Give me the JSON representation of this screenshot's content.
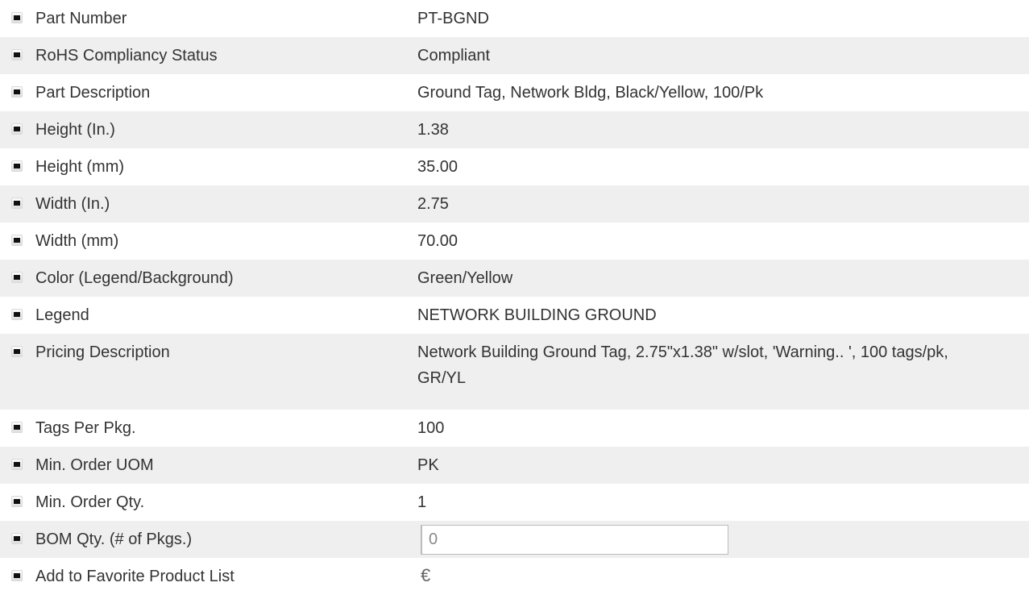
{
  "rows": [
    {
      "label": "Part Number",
      "value": "PT-BGND"
    },
    {
      "label": "RoHS Compliancy Status",
      "value": "Compliant"
    },
    {
      "label": "Part Description",
      "value": "Ground Tag, Network Bldg, Black/Yellow, 100/Pk"
    },
    {
      "label": "Height (In.)",
      "value": "1.38"
    },
    {
      "label": "Height (mm)",
      "value": "35.00"
    },
    {
      "label": "Width (In.)",
      "value": "2.75"
    },
    {
      "label": "Width (mm)",
      "value": "70.00"
    },
    {
      "label": "Color (Legend/Background)",
      "value": "Green/Yellow"
    },
    {
      "label": "Legend",
      "value": "NETWORK BUILDING GROUND"
    },
    {
      "label": "Pricing Description",
      "value": "Network Building Ground Tag, 2.75\"x1.38\" w/slot, 'Warning.. ', 100 tags/pk, GR/YL"
    },
    {
      "label": "Tags Per Pkg.",
      "value": "100"
    },
    {
      "label": "Min. Order UOM",
      "value": "PK"
    },
    {
      "label": "Min. Order Qty.",
      "value": "1"
    }
  ],
  "bom_qty": {
    "label": "BOM Qty. (# of Pkgs.)",
    "value": "0"
  },
  "favorite": {
    "label": "Add to Favorite Product List",
    "glyph": "€",
    "icon": "favorite-icon"
  },
  "colors": {
    "shaded_row": "#efefef",
    "text": "#333333",
    "input_border": "#bcbcbc"
  }
}
